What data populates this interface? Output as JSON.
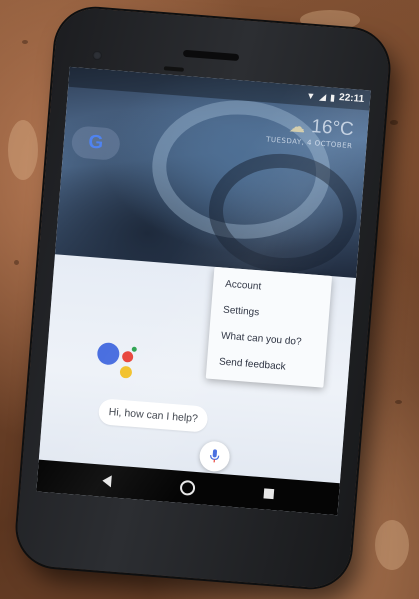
{
  "status_bar": {
    "time": "22:11",
    "icons": [
      "wifi-icon",
      "signal-icon",
      "battery-icon"
    ]
  },
  "weather": {
    "temperature": "16°C",
    "date": "Tuesday, 4 October",
    "icon": "partly-cloudy-icon"
  },
  "search": {
    "logo_text": "G"
  },
  "assistant": {
    "greeting": "Hi, how can I help?",
    "mic_icon": "mic-icon",
    "logo_colors": [
      "#4a6fe0",
      "#e8453c",
      "#f2c12b",
      "#2fa352"
    ]
  },
  "menu": {
    "items": [
      "Account",
      "Settings",
      "What can you do?",
      "Send feedback"
    ]
  },
  "nav_bar": {
    "buttons": [
      "back-icon",
      "home-icon",
      "recents-icon"
    ]
  }
}
